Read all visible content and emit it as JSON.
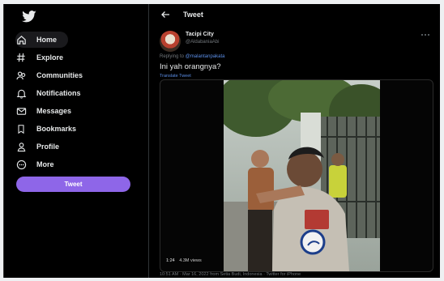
{
  "sidebar": {
    "logo_icon": "twitter-bird-icon",
    "items": [
      {
        "label": "Home",
        "icon": "home-icon"
      },
      {
        "label": "Explore",
        "icon": "hashtag-icon"
      },
      {
        "label": "Communities",
        "icon": "communities-icon"
      },
      {
        "label": "Notifications",
        "icon": "bell-icon"
      },
      {
        "label": "Messages",
        "icon": "envelope-icon"
      },
      {
        "label": "Bookmarks",
        "icon": "bookmark-icon"
      },
      {
        "label": "Profile",
        "icon": "person-icon"
      },
      {
        "label": "More",
        "icon": "more-circle-icon"
      }
    ],
    "tweet_button": "Tweet"
  },
  "header": {
    "title": "Tweet"
  },
  "tweet": {
    "author_name": "Tacipi City",
    "author_handle": "@AldabaniaAbi",
    "replying_prefix": "Replying to",
    "replying_to": "@malantanpakata",
    "text": "Ini yah orangnya?",
    "translate": "Translate Tweet",
    "video_time": "1:24",
    "video_views": "4.3M views",
    "timestamp": "10:51 AM · Mar 16, 2022 from Setia Budi, Indonesia · Twitter for iPhone"
  },
  "colors": {
    "accent": "#8e66e8",
    "link": "#5b8ee6",
    "background": "#000000",
    "text_primary": "#e7e9ea",
    "text_secondary": "#71767b"
  }
}
